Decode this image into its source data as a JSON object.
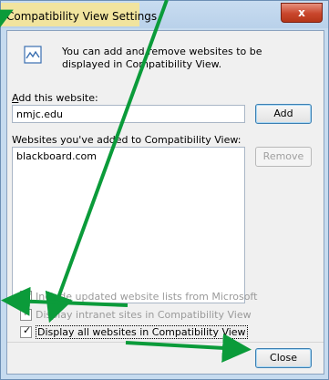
{
  "window": {
    "title": "Compatibility View Settings",
    "close_glyph": "x"
  },
  "info": {
    "text": "You can add and remove websites to be displayed in Compatibility View."
  },
  "add_section": {
    "label": "Add this website:",
    "value": "nmjc.edu",
    "add_button": "Add"
  },
  "list_section": {
    "label": "Websites you've added to Compatibility View:",
    "items": [
      "blackboard.com"
    ],
    "remove_button": "Remove"
  },
  "options": [
    {
      "label": "Include updated website lists from Microsoft",
      "checked": true,
      "enabled": false
    },
    {
      "label": "Display intranet sites in Compatibility View",
      "checked": true,
      "enabled": false
    },
    {
      "label": "Display all websites in Compatibility View",
      "checked": true,
      "enabled": true
    }
  ],
  "footer": {
    "close_button": "Close"
  },
  "colors": {
    "annotation_arrow": "#0b9b3a",
    "title_highlight": "#f3e59a"
  }
}
